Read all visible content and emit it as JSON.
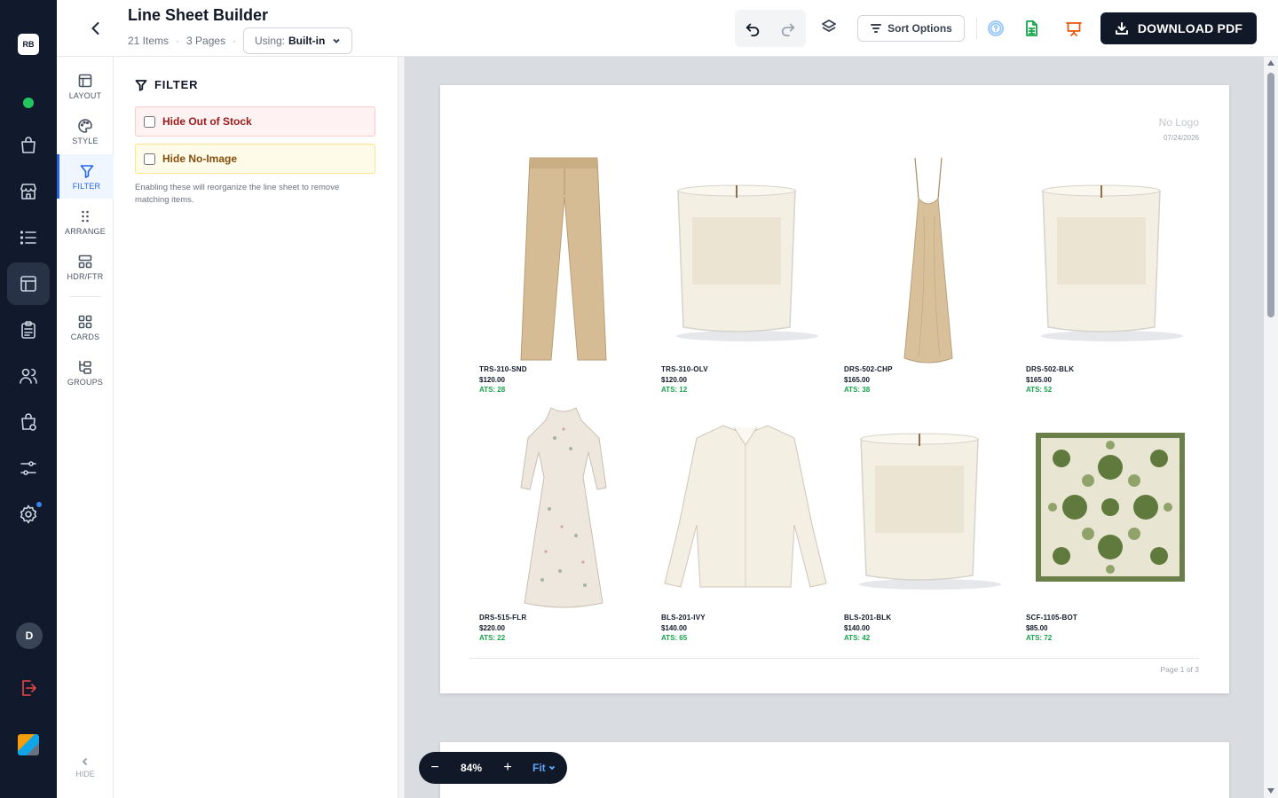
{
  "rail": {
    "logo_text": "RB",
    "user_initial": "D",
    "icons": [
      "status-online-icon",
      "bag-icon",
      "store-icon",
      "list-icon",
      "layout-icon",
      "clipboard-icon",
      "users-icon",
      "bag-settings-icon",
      "sliders-icon",
      "settings-icon",
      "logout-icon"
    ]
  },
  "header": {
    "title": "Line Sheet Builder",
    "items_count": "21 Items",
    "pages_count": "3 Pages",
    "using_label": "Using:",
    "using_value": "Built-in",
    "sort_label": "Sort Options",
    "download_label": "DOWNLOAD PDF"
  },
  "tabs": [
    {
      "label": "LAYOUT",
      "icon": "layout-icon"
    },
    {
      "label": "STYLE",
      "icon": "palette-icon"
    },
    {
      "label": "FILTER",
      "icon": "filter-icon",
      "active": true
    },
    {
      "label": "ARRANGE",
      "icon": "drag-dots-icon"
    },
    {
      "label": "HDR/FTR",
      "icon": "header-footer-icon"
    },
    {
      "label": "CARDS",
      "icon": "grid-icon"
    },
    {
      "label": "GROUPS",
      "icon": "groups-icon"
    }
  ],
  "hide_label": "HIDE",
  "filter": {
    "title": "FILTER",
    "options": [
      {
        "label": "Hide Out of Stock",
        "checked": false,
        "color": "#991b1b"
      },
      {
        "label": "Hide No-Image",
        "checked": false,
        "color": "#854d0e"
      }
    ],
    "help": "Enabling these will reorganize the line sheet to remove matching items."
  },
  "page": {
    "no_logo": "No Logo",
    "date": "07/24/2026",
    "page_label": "Page 1 of 3",
    "products": [
      {
        "sku": "TRS-310-SND",
        "price": "$120.00",
        "ats": "ATS: 28",
        "image": "pants-icon"
      },
      {
        "sku": "TRS-310-OLV",
        "price": "$120.00",
        "ats": "ATS: 12",
        "image": "candle-icon"
      },
      {
        "sku": "DRS-502-CHP",
        "price": "$165.00",
        "ats": "ATS: 38",
        "image": "slip-dress-icon"
      },
      {
        "sku": "DRS-502-BLK",
        "price": "$165.00",
        "ats": "ATS: 52",
        "image": "candle-icon"
      },
      {
        "sku": "DRS-515-FLR",
        "price": "$220.00",
        "ats": "ATS: 22",
        "image": "floral-dress-icon"
      },
      {
        "sku": "BLS-201-IVY",
        "price": "$140.00",
        "ats": "ATS: 65",
        "image": "blouse-icon"
      },
      {
        "sku": "BLS-201-BLK",
        "price": "$140.00",
        "ats": "ATS: 42",
        "image": "candle-icon"
      },
      {
        "sku": "SCF-1105-BOT",
        "price": "$85.00",
        "ats": "ATS: 72",
        "image": "scarf-icon"
      }
    ]
  },
  "zoom": {
    "value": "84%",
    "minus": "−",
    "plus": "+",
    "fit_label": "Fit"
  },
  "colors": {
    "accent": "#2563eb",
    "ats_green": "#16a34a",
    "dark": "#111827"
  }
}
